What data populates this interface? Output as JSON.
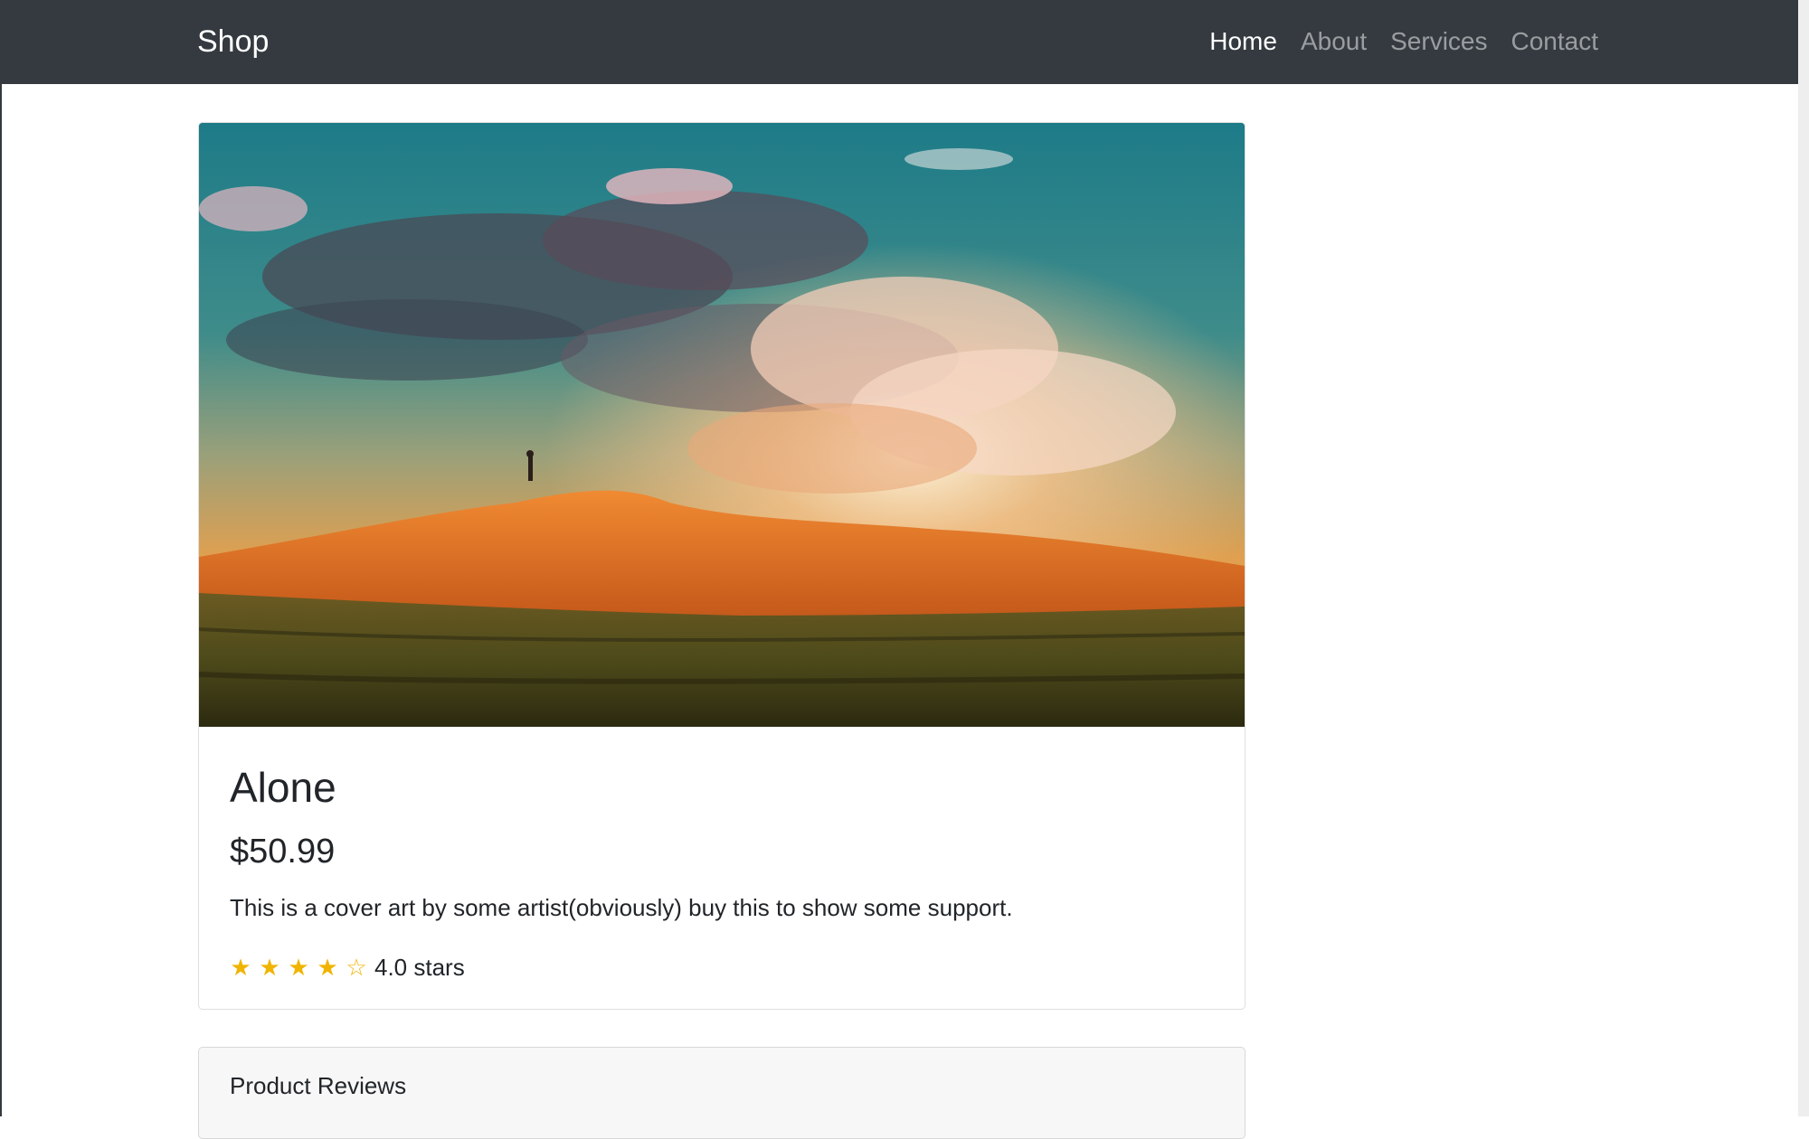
{
  "navbar": {
    "brand": "Shop",
    "links": [
      {
        "label": "Home",
        "active": true
      },
      {
        "label": "About",
        "active": false
      },
      {
        "label": "Services",
        "active": false
      },
      {
        "label": "Contact",
        "active": false
      }
    ]
  },
  "product": {
    "image_icon": "landscape-painting-image",
    "title": "Alone",
    "price": "$50.99",
    "description": "This is a cover art by some artist(obviously) buy this to show some support.",
    "rating_value": 4.0,
    "rating_max": 5,
    "rating_text": "4.0 stars",
    "star_color": "#f0b400"
  },
  "reviews": {
    "header": "Product Reviews"
  },
  "colors": {
    "navbar_bg": "#343a40",
    "nav_active": "#ffffff",
    "nav_inactive": "rgba(255,255,255,0.5)"
  }
}
